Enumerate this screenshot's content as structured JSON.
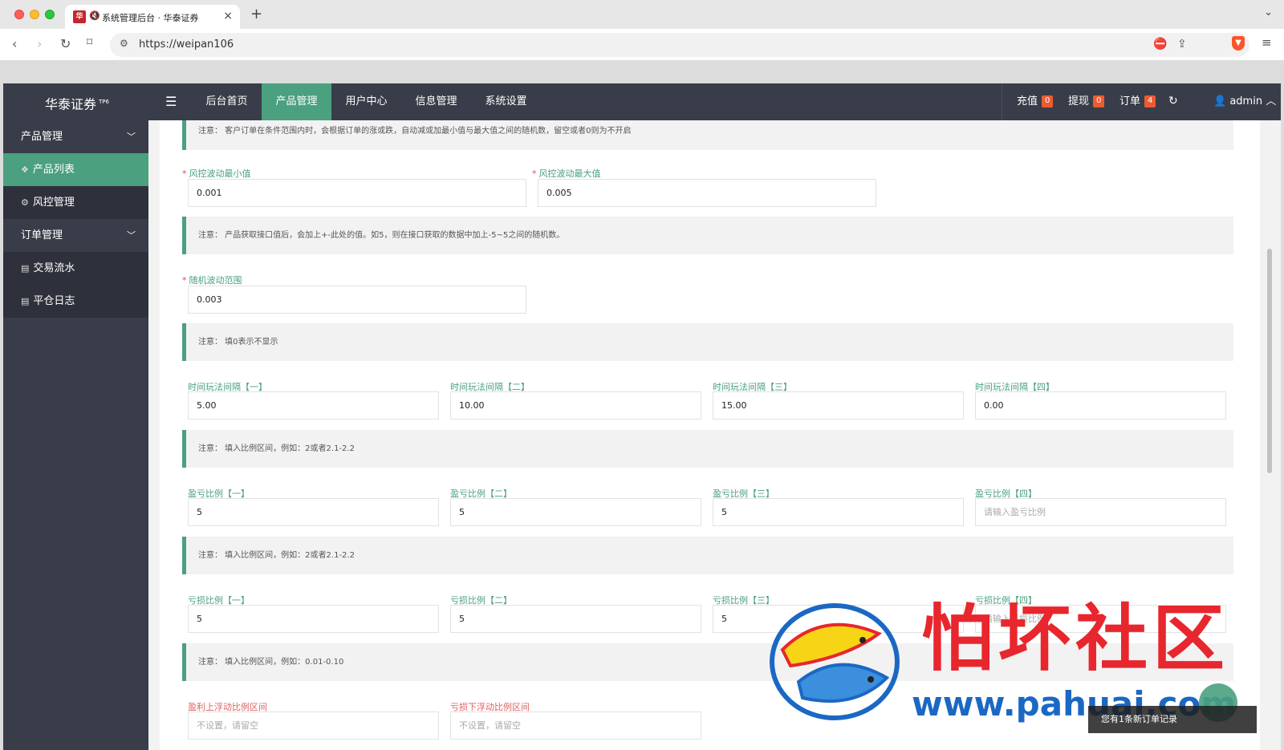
{
  "browser": {
    "tab_title": "系统管理后台 · 华泰证券",
    "favicon_text": "华",
    "url": "https://weipan106"
  },
  "app": {
    "logo": "华泰证券",
    "logo_sup": "TP6",
    "nav": [
      "后台首页",
      "产品管理",
      "用户中心",
      "信息管理",
      "系统设置"
    ],
    "active_nav": "产品管理",
    "recharge_label": "充值",
    "recharge_count": "0",
    "withdraw_label": "提现",
    "withdraw_count": "0",
    "order_label": "订单",
    "order_count": "4",
    "user": "admin"
  },
  "sidebar": {
    "groups": [
      {
        "label": "产品管理",
        "items": [
          {
            "label": "产品列表",
            "icon": "layers-icon"
          },
          {
            "label": "风控管理",
            "icon": "gear-icon"
          }
        ]
      },
      {
        "label": "订单管理",
        "items": [
          {
            "label": "交易流水",
            "icon": "doc-icon"
          },
          {
            "label": "平仓日志",
            "icon": "doc-icon"
          }
        ]
      }
    ],
    "active_item": "产品列表"
  },
  "form": {
    "note1": "注意：  客户订单在条件范围内时，会根据订单的涨或跌，自动减或加最小值与最大值之间的随机数，留空或者0则为不开启",
    "risk_min_label": "风控波动最小值",
    "risk_min_value": "0.001",
    "risk_max_label": "风控波动最大值",
    "risk_max_value": "0.005",
    "note2": "注意：  产品获取接口值后，会加上+-此处的值。如5，则在接口获取的数据中加上-5~5之间的随机数。",
    "random_label": "随机波动范围",
    "random_value": "0.003",
    "note3": "注意：  填0表示不显示",
    "interval_labels": [
      "时间玩法间隔【一】",
      "时间玩法间隔【二】",
      "时间玩法间隔【三】",
      "时间玩法间隔【四】"
    ],
    "interval_values": [
      "5.00",
      "10.00",
      "15.00",
      "0.00"
    ],
    "note4": "注意：  填入比例区间，例如：2或者2.1-2.2",
    "profit_labels": [
      "盈亏比例【一】",
      "盈亏比例【二】",
      "盈亏比例【三】",
      "盈亏比例【四】"
    ],
    "profit_values": [
      "5",
      "5",
      "5",
      ""
    ],
    "profit_placeholder4": "请输入盈亏比例",
    "note5": "注意：  填入比例区间，例如：2或者2.1-2.2",
    "loss_labels": [
      "亏损比例【一】",
      "亏损比例【二】",
      "亏损比例【三】",
      "亏损比例【四】"
    ],
    "loss_values": [
      "5",
      "5",
      "5",
      ""
    ],
    "loss_placeholder4": "请输入亏损比例",
    "note6": "注意：  填入比例区间，例如：0.01-0.10",
    "float_up_label": "盈利上浮动比例区间",
    "float_up_placeholder": "不设置，请留空",
    "float_down_label": "亏损下浮动比例区间",
    "float_down_placeholder": "不设置，请留空"
  },
  "watermark": {
    "title": "怕坏社区",
    "url": "www.pahuai.com",
    "toast": "您有1条新订单记录"
  },
  "colors": {
    "accent": "#4aa07f",
    "nav_bg": "#393d49",
    "badge": "#ee5b30",
    "watermark_red": "#e8262e",
    "watermark_blue": "#1b68c3"
  }
}
